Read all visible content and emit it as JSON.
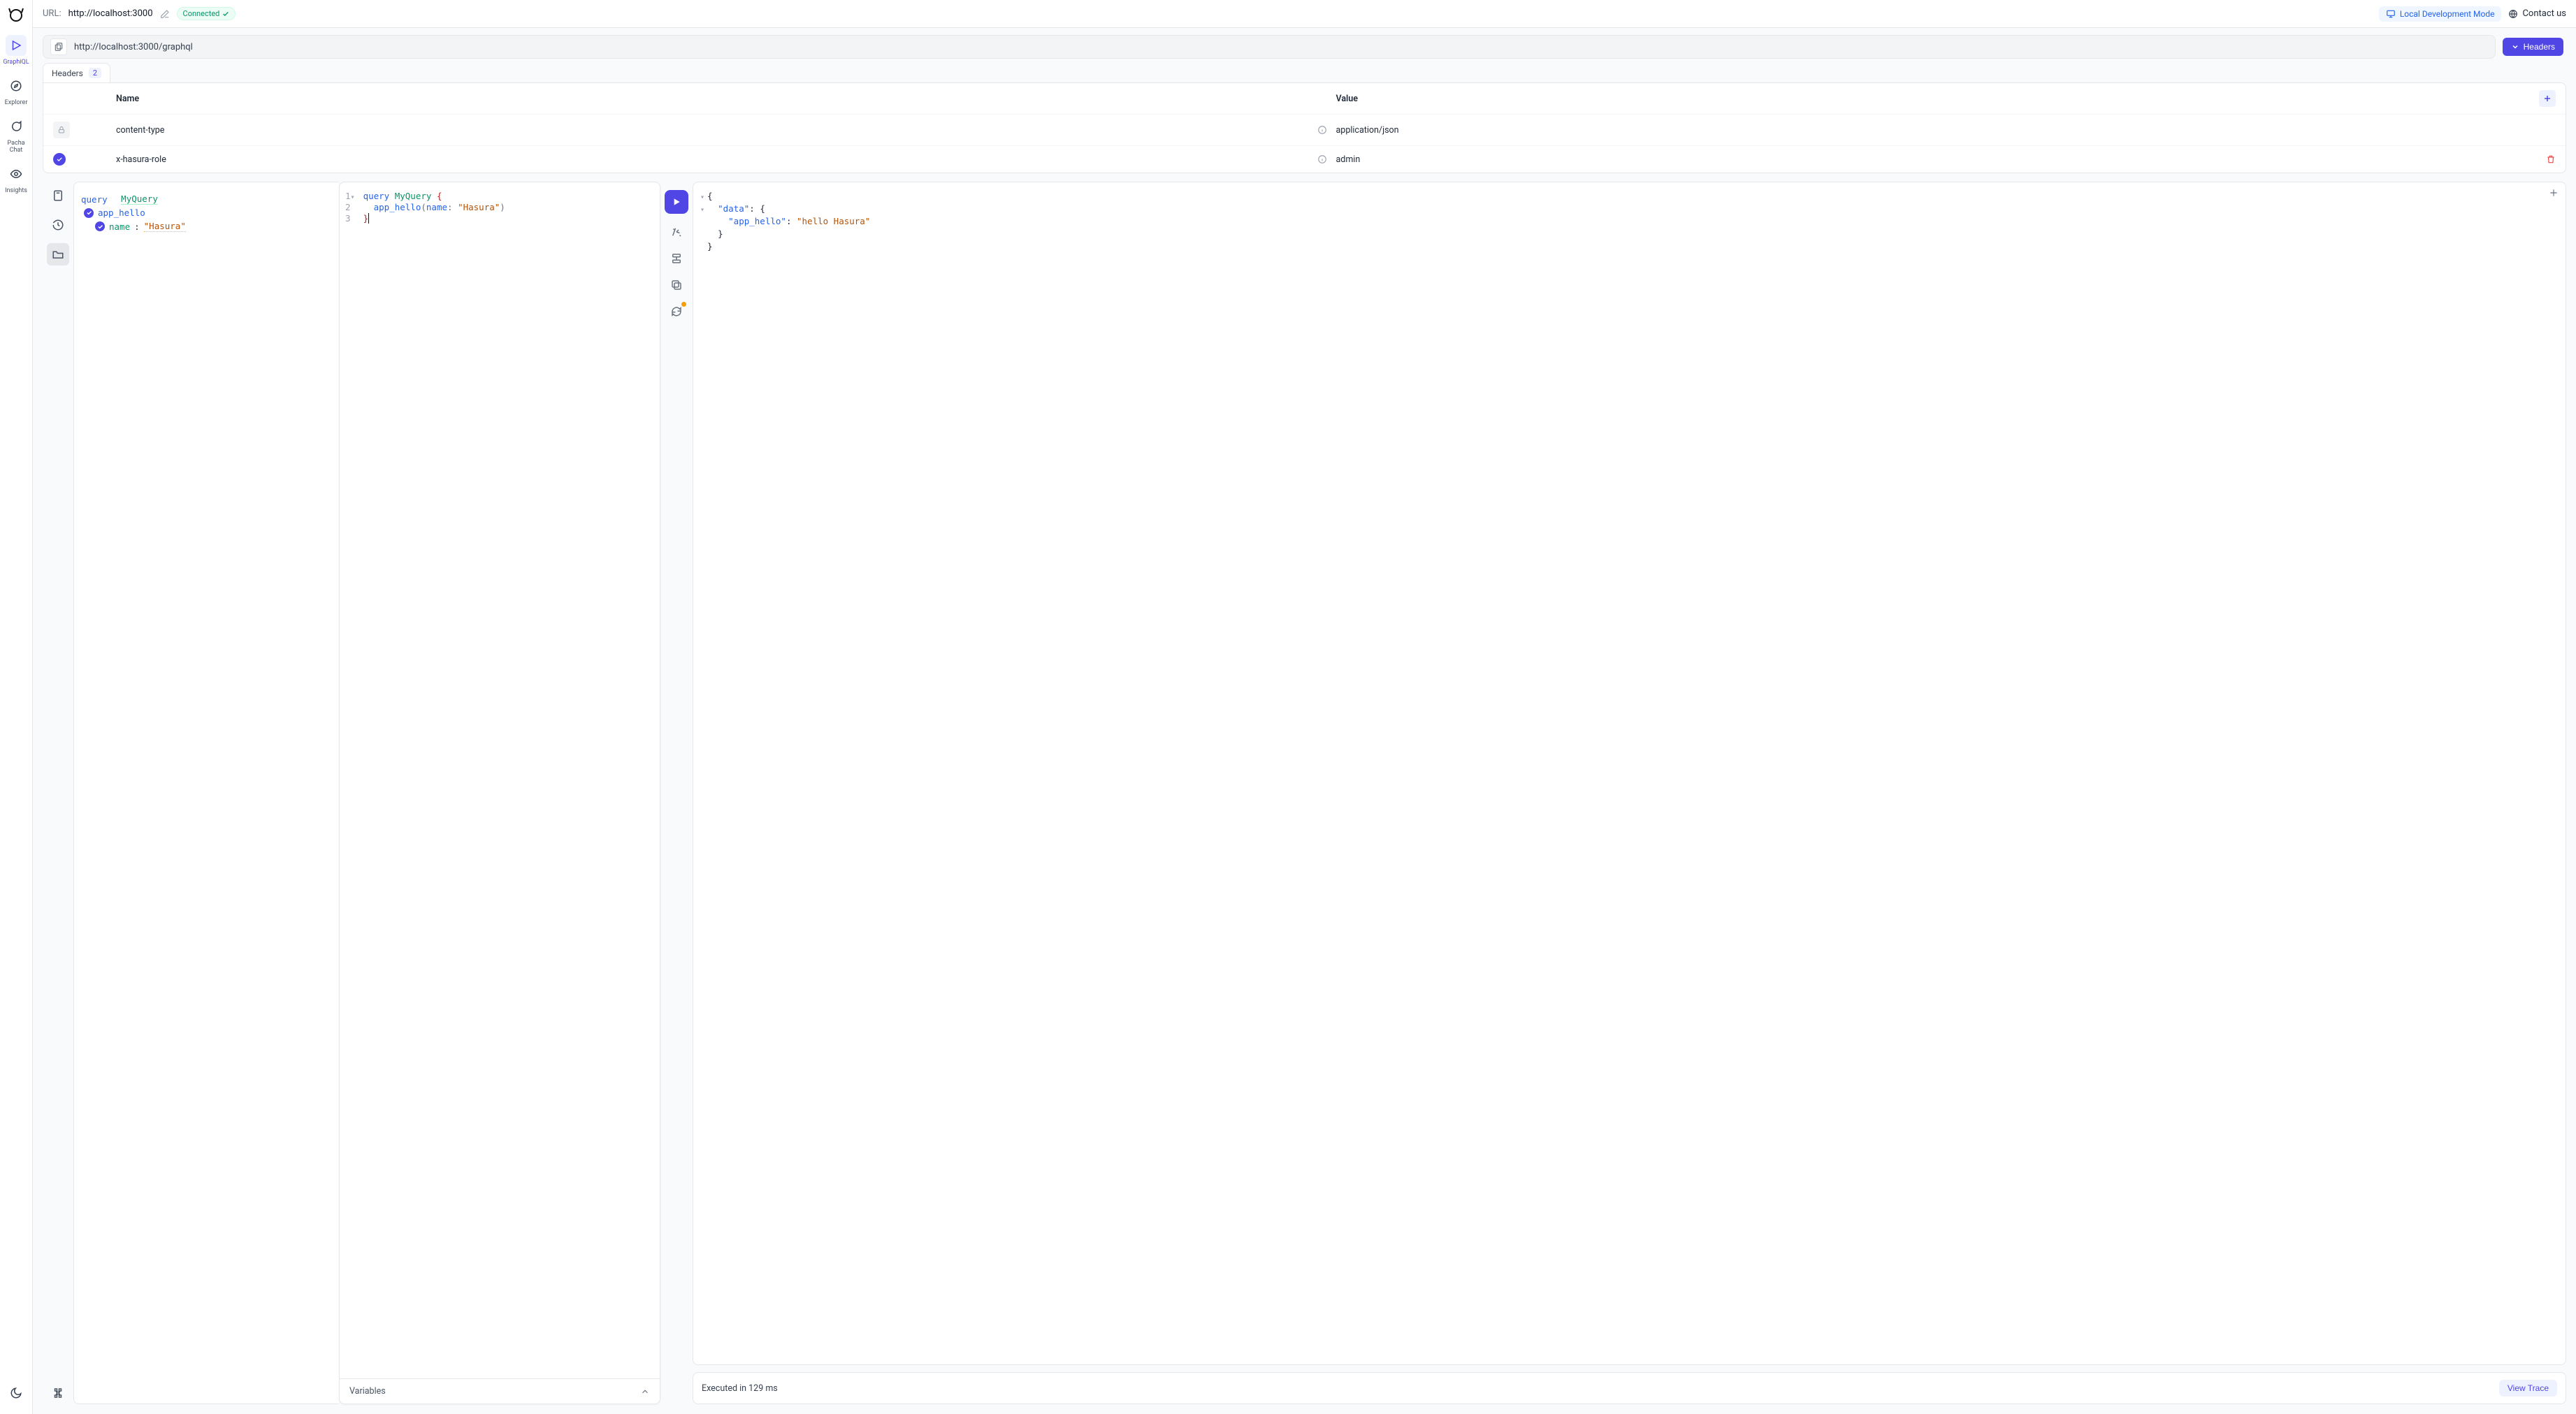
{
  "topbar": {
    "url_label": "URL:",
    "url_value": "http://localhost:3000",
    "connected": "Connected",
    "local_mode": "Local Development Mode",
    "contact": "Contact us"
  },
  "sidebar": {
    "items": [
      {
        "label": "GraphiQL"
      },
      {
        "label": "Explorer"
      },
      {
        "label": "Pacha Chat"
      },
      {
        "label": "Insights"
      }
    ]
  },
  "urlbar": {
    "endpoint": "http://localhost:3000/graphql",
    "headers_btn": "Headers"
  },
  "headers": {
    "tab_label": "Headers",
    "count": "2",
    "col_name": "Name",
    "col_value": "Value",
    "rows": [
      {
        "name": "content-type",
        "value": "application/json",
        "locked": true
      },
      {
        "name": "x-hasura-role",
        "value": "admin",
        "locked": false
      }
    ]
  },
  "explorer": {
    "query_kw": "query",
    "query_name": "MyQuery",
    "field": "app_hello",
    "arg_name": "name",
    "arg_sep": ":",
    "arg_value": "\"Hasura\""
  },
  "editor": {
    "lines": [
      {
        "n": "1",
        "fold": "▾",
        "text_kw": "query ",
        "text_name": "MyQuery ",
        "brace_open": "{"
      },
      {
        "n": "2",
        "fold": "",
        "indent": "  ",
        "call": "app_hello",
        "paren_open": "(",
        "arg": "name",
        "colon": ": ",
        "str": "\"Hasura\"",
        "paren_close": ")"
      },
      {
        "n": "3",
        "fold": "",
        "brace_close": "}"
      }
    ],
    "variables_label": "Variables"
  },
  "result": {
    "lines": [
      {
        "fold": "▾",
        "indent": "",
        "open": "{"
      },
      {
        "fold": "▾",
        "indent": "  ",
        "key": "\"data\"",
        "sep": ": ",
        "open": "{"
      },
      {
        "fold": "",
        "indent": "    ",
        "key": "\"app_hello\"",
        "sep": ": ",
        "val": "\"hello Hasura\""
      },
      {
        "fold": "",
        "indent": "  ",
        "close": "}"
      },
      {
        "fold": "",
        "indent": "",
        "close": "}"
      }
    ],
    "footer_text": "Executed in 129 ms",
    "trace_btn": "View Trace"
  }
}
